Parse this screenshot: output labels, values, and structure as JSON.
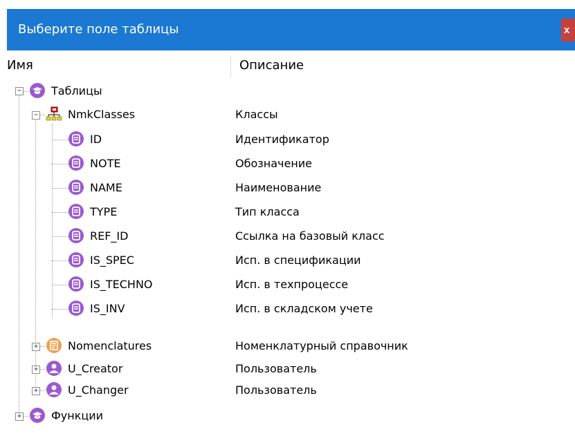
{
  "dialog": {
    "title": "Выберите поле таблицы",
    "close_label": "x"
  },
  "columns": {
    "name": "Имя",
    "description": "Описание"
  },
  "tree": {
    "root_tables": {
      "label": "Таблицы",
      "expanded": true,
      "icon": "tables-group-icon"
    },
    "nmkclasses": {
      "label": "NmkClasses",
      "description": "Классы",
      "expanded": true,
      "icon": "class-hierarchy-icon"
    },
    "fields": [
      {
        "label": "ID",
        "description": "Идентификатор",
        "icon": "field-icon"
      },
      {
        "label": "NOTE",
        "description": "Обозначение",
        "icon": "field-icon"
      },
      {
        "label": "NAME",
        "description": "Наименование",
        "icon": "field-icon"
      },
      {
        "label": "TYPE",
        "description": "Тип класса",
        "icon": "field-icon"
      },
      {
        "label": "REF_ID",
        "description": "Ссылка на базовый класс",
        "icon": "field-icon"
      },
      {
        "label": "IS_SPEC",
        "description": "Исп. в спецификации",
        "icon": "field-icon"
      },
      {
        "label": "IS_TECHNO",
        "description": "Исп. в техпроцессе",
        "icon": "field-icon"
      },
      {
        "label": "IS_INV",
        "description": "Исп. в складском учете",
        "icon": "field-icon"
      }
    ],
    "nomenclatures": {
      "label": "Nomenclatures",
      "description": "Номенклатурный справочник",
      "expanded": false,
      "icon": "catalog-icon"
    },
    "u_creator": {
      "label": "U_Creator",
      "description": "Пользователь",
      "expanded": false,
      "icon": "user-icon"
    },
    "u_changer": {
      "label": "U_Changer",
      "description": "Пользователь",
      "expanded": false,
      "icon": "user-icon"
    },
    "root_functions": {
      "label": "Функции",
      "expanded": false,
      "icon": "functions-group-icon"
    }
  },
  "colors": {
    "titlebar": "#1b78d3",
    "close_button": "#c8403c",
    "purple_icon": "#9b59d0",
    "orange_icon": "#f0a050"
  }
}
